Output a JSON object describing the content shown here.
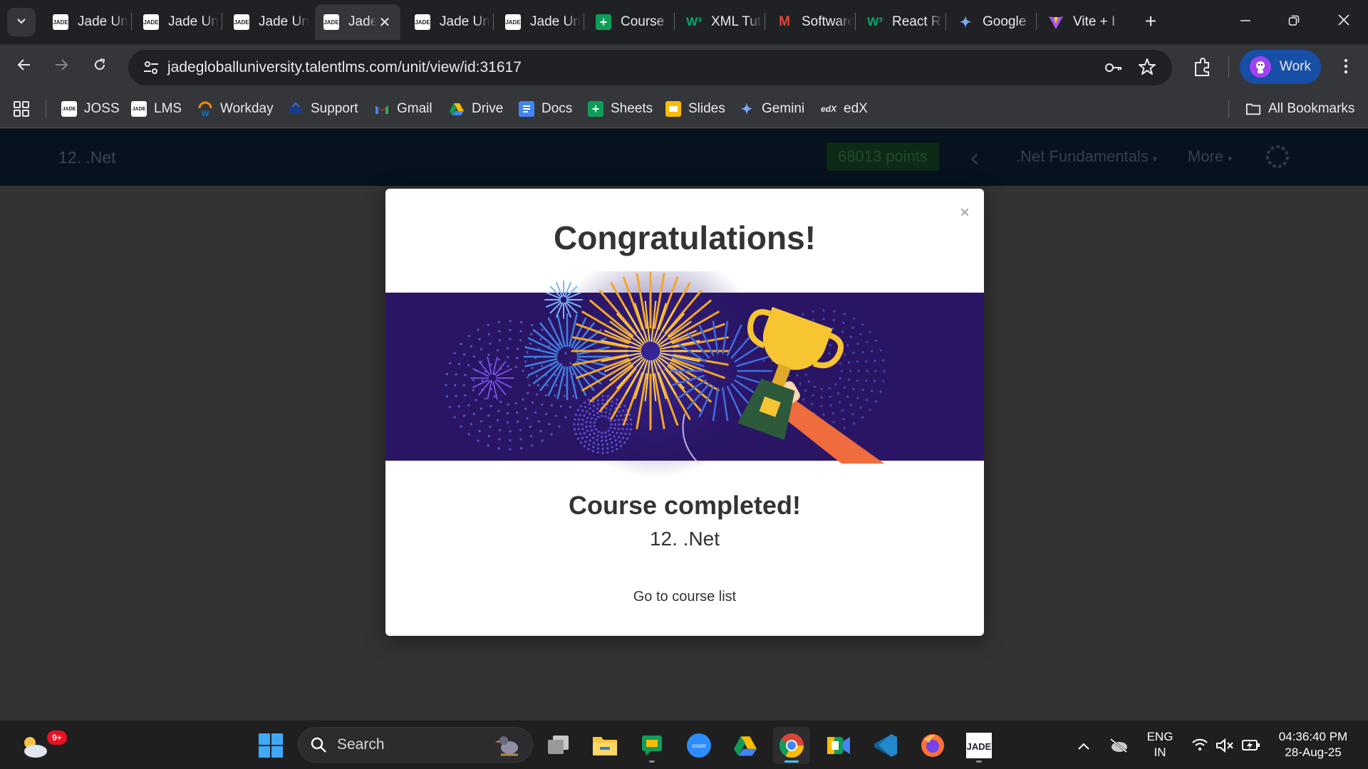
{
  "browser": {
    "tabs": [
      {
        "title": "Jade University",
        "favicon": "jade-logo-icon",
        "active": false
      },
      {
        "title": "Jade University",
        "favicon": "jade-logo-icon",
        "active": false
      },
      {
        "title": "Jade University",
        "favicon": "jade-logo-icon",
        "active": false
      },
      {
        "title": "Jade University",
        "favicon": "jade-logo-icon",
        "active": true
      },
      {
        "title": "Jade University",
        "favicon": "jade-logo-icon",
        "active": false
      },
      {
        "title": "Jade University",
        "favicon": "jade-logo-icon",
        "active": false
      },
      {
        "title": "Course",
        "favicon": "sheets-icon",
        "active": false
      },
      {
        "title": "XML Tutorial",
        "favicon": "w3schools-icon",
        "active": false
      },
      {
        "title": "Software",
        "favicon": "gmail-icon",
        "active": false
      },
      {
        "title": "React R",
        "favicon": "w3schools-icon",
        "active": false
      },
      {
        "title": "Google",
        "favicon": "gemini-icon",
        "active": false
      },
      {
        "title": "Vite + I",
        "favicon": "vite-icon",
        "active": false
      }
    ],
    "url_host": "jadegloballuniversity.talentlms.com",
    "url_path": "/unit/view/id:31617",
    "profile_label": "Work",
    "bookmarks": [
      {
        "label": "JOSS",
        "icon": "jade-logo-icon"
      },
      {
        "label": "LMS",
        "icon": "jade-logo-icon"
      },
      {
        "label": "Workday",
        "icon": "workday-icon"
      },
      {
        "label": "Support",
        "icon": "support-icon"
      },
      {
        "label": "Gmail",
        "icon": "gmail-icon"
      },
      {
        "label": "Drive",
        "icon": "drive-icon"
      },
      {
        "label": "Docs",
        "icon": "docs-icon"
      },
      {
        "label": "Sheets",
        "icon": "sheets-icon"
      },
      {
        "label": "Slides",
        "icon": "slides-icon"
      },
      {
        "label": "Gemini",
        "icon": "gemini-icon"
      },
      {
        "label": "edX",
        "icon": "edx-icon"
      }
    ],
    "all_bookmarks_label": "All Bookmarks"
  },
  "lms": {
    "course_name": "12. .Net",
    "points": "68013 points",
    "unit_menu": ".Net Fundamentals",
    "more_menu": "More"
  },
  "modal": {
    "title": "Congratulations!",
    "completed_text": "Course completed!",
    "course_name": "12. .Net",
    "link_text": "Go to course list",
    "close_symbol": "×"
  },
  "taskbar": {
    "notification_badge": "9+",
    "search_placeholder": "Search",
    "apps": [
      "start-icon",
      "task-view-icon",
      "file-explorer-icon",
      "chat-icon",
      "zoom-icon",
      "google-drive-icon",
      "chrome-icon",
      "meet-icon",
      "vscode-icon",
      "firefox-icon",
      "jade-logo-icon"
    ],
    "language_line1": "ENG",
    "language_line2": "IN",
    "time": "04:36:40 PM",
    "date": "28-Aug-25"
  },
  "colors": {
    "browser_dark": "#202124",
    "toolbar": "#35363a",
    "page_overlay": "#333333",
    "lms_header": "#06121d",
    "modal_bg": "#ffffff",
    "banner_bg": "#2a1565",
    "profile_chip": "#174ea6"
  }
}
